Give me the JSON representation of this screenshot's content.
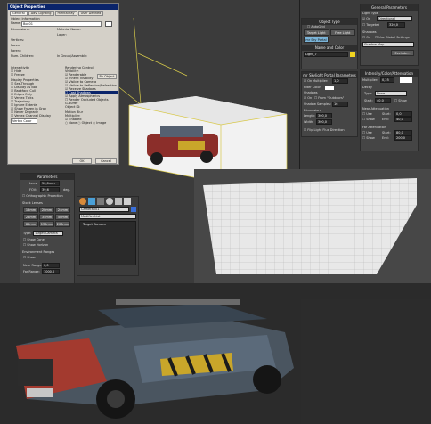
{
  "object_properties": {
    "title": "Object Properties",
    "tabs": [
      "General",
      "Adv. Lighting",
      "mental ray",
      "User Defined"
    ],
    "info_title": "Object Information",
    "name_label": "Name:",
    "name_value": "Box01",
    "fields": [
      "Dimensions:",
      "Vertices:",
      "Faces:",
      "Parent:",
      "Num. Children:",
      "Material Name:",
      "Layer:",
      "In Group/Assembly:"
    ],
    "interactivity": "Interactivity",
    "hide": "Hide",
    "freeze": "Freeze",
    "display_props": "Display Properties",
    "display_items": [
      "See-Through",
      "Display as Box",
      "Backface Cull",
      "Edges Only",
      "Vertex Ticks",
      "Trajectory",
      "Ignore Extents",
      "Show Frozen in Gray",
      "Never Degrade",
      "Vertex Channel Display"
    ],
    "vertex_color": "Vertex Color",
    "rendering_control": "Rendering Control",
    "render_items": [
      "Visibility:",
      "Renderable",
      "Inherit Visibility",
      "Visible to Camera",
      "Visible to Reflection/Refraction",
      "Receive Shadows",
      "Cast Shadows",
      "Apply Atmospherics",
      "Render Occluded Objects"
    ],
    "by_object": "By Object",
    "g_buffer": "G-Buffer",
    "object_id": "Object ID:",
    "motion_blur": "Motion Blur",
    "multiplier": "Multiplier:",
    "enabled": "Enabled",
    "blur_types": [
      "None",
      "Object",
      "Image"
    ],
    "ok": "OK",
    "cancel": "Cancel"
  },
  "object_type": {
    "title": "Object Type",
    "autogrid": "AutoGrid",
    "buttons": [
      "Target Light",
      "Free Light",
      "mr Sky Portal"
    ],
    "name_color_title": "Name and Color",
    "name_value": "Light_7"
  },
  "sky_portal": {
    "title": "mr Skylight Portal Parameters",
    "on": "On",
    "multiplier_label": "Multiplier:",
    "multiplier_value": "1,0",
    "filter_color": "Filter Color:",
    "shadows": "Shadows",
    "from_outdoors": "From \"Outdoors\"",
    "shadow_samples": "Shadow Samples:",
    "shadow_samples_value": "16",
    "dimensions": "Dimensions",
    "length_label": "Length:",
    "length_value": "300,0",
    "width_label": "Width:",
    "width_value": "300,0",
    "flip": "Flip Light Flux Direction"
  },
  "general_params": {
    "title": "General Parameters",
    "light_type": "Light Type",
    "on": "On",
    "type_value": "Directional",
    "targeted": "Targeted",
    "targeted_value": "320,0",
    "shadows": "Shadows",
    "use_global": "Use Global Settings",
    "shadow_map": "Shadow Map",
    "exclude": "Exclude..."
  },
  "intensity": {
    "title": "Intensity/Color/Attenuation",
    "multiplier_label": "Multiplier:",
    "multiplier_value": "0,25",
    "decay": "Decay",
    "type_label": "Type:",
    "type_value": "None",
    "start_label": "Start:",
    "start_value": "40,0",
    "show": "Show",
    "near_atten": "Near Attenuation",
    "far_atten": "Far Attenuation",
    "use": "Use",
    "end_label": "End:",
    "near_start": "0,0",
    "near_end": "40,0",
    "far_start": "80,0",
    "far_end": "200,0"
  },
  "camera_params": {
    "title": "Parameters",
    "lens_label": "Lens:",
    "lens_value": "50,0mm",
    "fov_label": "FOV:",
    "fov_value": "39,6",
    "fov_unit": "deg.",
    "ortho": "Orthographic Projection",
    "stock_lenses": "Stock Lenses",
    "lenses": [
      "15mm",
      "20mm",
      "24mm",
      "28mm",
      "35mm",
      "50mm",
      "85mm",
      "135mm",
      "200mm"
    ],
    "type_label": "Type:",
    "type_value": "Target Camera",
    "show_cone": "Show Cone",
    "show_horizon": "Show Horizon",
    "env_ranges": "Environment Ranges",
    "show": "Show",
    "near_range": "Near Range:",
    "near_value": "0,0",
    "far_range": "Far Range:",
    "far_value": "1000,0"
  },
  "modifier_panel": {
    "object_name": "Camera001",
    "modifier_list": "Modifier List",
    "stack_item": "Target Camera"
  }
}
